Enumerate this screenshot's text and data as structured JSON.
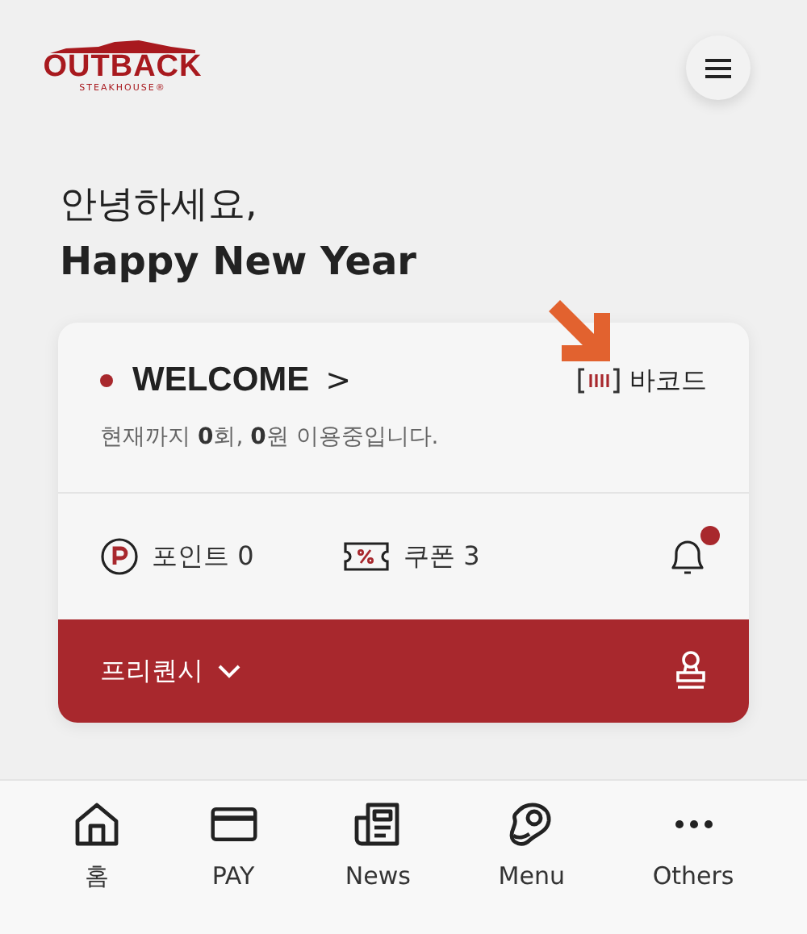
{
  "header": {
    "logo": {
      "name": "OUTBACK",
      "tagline": "STEAKHOUSE®"
    }
  },
  "greeting": {
    "line1": "안녕하세요,",
    "line2": "Happy New Year"
  },
  "card": {
    "grade": "WELCOME",
    "grade_arrow": ">",
    "summary": "현재까지 **0**회, **0**원 이용중입니다.",
    "barcode_label": "바코드",
    "points": {
      "label": "포인트 0"
    },
    "coupons": {
      "label": "쿠폰 3"
    },
    "notifications": {
      "unread": true
    },
    "footer": {
      "label": "프리퀀시"
    }
  },
  "annotation": {
    "kind": "arrow"
  },
  "bottom_nav": [
    {
      "label": "홈",
      "kind": "home"
    },
    {
      "label": "PAY",
      "kind": "card"
    },
    {
      "label": "News",
      "kind": "news"
    },
    {
      "label": "Menu",
      "kind": "steak"
    },
    {
      "label": "Others",
      "kind": "more"
    }
  ]
}
